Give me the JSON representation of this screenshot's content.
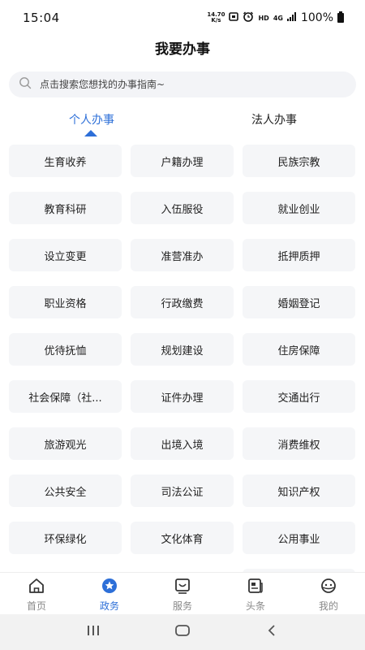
{
  "status_bar": {
    "time": "15:04",
    "net_speed_value": "14.70",
    "net_speed_unit": "K/s",
    "hd_label": "HD",
    "network_label": "4G",
    "battery": "100%"
  },
  "page": {
    "title": "我要办事"
  },
  "search": {
    "placeholder": "点击搜索您想找的办事指南~"
  },
  "tabs": {
    "personal": "个人办事",
    "legal": "法人办事",
    "active": "personal"
  },
  "services": [
    "生育收养",
    "户籍办理",
    "民族宗教",
    "教育科研",
    "入伍服役",
    "就业创业",
    "设立变更",
    "准营准办",
    "抵押质押",
    "职业资格",
    "行政缴费",
    "婚姻登记",
    "优待抚恤",
    "规划建设",
    "住房保障",
    "社会保障（社...",
    "证件办理",
    "交通出行",
    "旅游观光",
    "出境入境",
    "消费维权",
    "公共安全",
    "司法公证",
    "知识产权",
    "环保绿化",
    "文化体育",
    "公用事业"
  ],
  "bottom_nav": {
    "items": [
      {
        "label": "首页",
        "icon": "home-icon"
      },
      {
        "label": "政务",
        "icon": "star-icon"
      },
      {
        "label": "服务",
        "icon": "service-icon"
      },
      {
        "label": "头条",
        "icon": "news-icon"
      },
      {
        "label": "我的",
        "icon": "profile-icon"
      }
    ],
    "active_index": 1
  },
  "colors": {
    "accent": "#2d6fd8",
    "tile_bg": "#f5f6f8",
    "search_bg": "#f3f4f7"
  }
}
